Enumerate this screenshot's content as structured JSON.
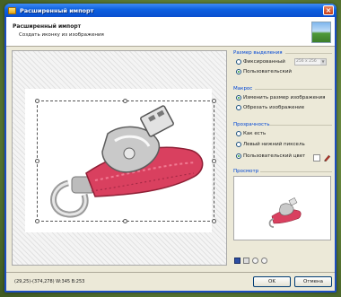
{
  "window": {
    "title": "Расширенный импорт",
    "close_glyph": "×"
  },
  "header": {
    "title": "Расширенный импорт",
    "subtitle": "Создать иконку из изображения"
  },
  "selection_size": {
    "label": "Размер выделения",
    "options": [
      {
        "label": "Фиксированный",
        "selected": false
      },
      {
        "label": "Пользовательский",
        "selected": true
      }
    ],
    "fixed_size_value": "256 x 256"
  },
  "macro": {
    "label": "Макрос",
    "options": [
      {
        "label": "Изменить размер изображения",
        "selected": true
      },
      {
        "label": "Обрезать изображение",
        "selected": false
      }
    ]
  },
  "transparency": {
    "label": "Прозрачность",
    "options": [
      {
        "label": "Как есть",
        "selected": false
      },
      {
        "label": "Левый нижний пиксель",
        "selected": false
      },
      {
        "label": "Пользовательский цвет",
        "selected": true
      }
    ],
    "custom_color": "#ffffff"
  },
  "preview": {
    "label": "Просмотр"
  },
  "status_text": "(29,25)-(374,278) W:345 B:253",
  "buttons": {
    "ok": "OK",
    "cancel": "Отмена"
  },
  "colors": {
    "titlebar": "#0c5fe0",
    "accent_group_label": "#0046d5",
    "dialog_bg": "#ece9d8",
    "usb_body": "#d9405f"
  },
  "icons": [
    "app-icon",
    "close-icon",
    "header-image-icon",
    "color-picker-pen-icon",
    "actual-size-icon",
    "fit-icon",
    "zoom-in-icon",
    "zoom-out-icon"
  ]
}
